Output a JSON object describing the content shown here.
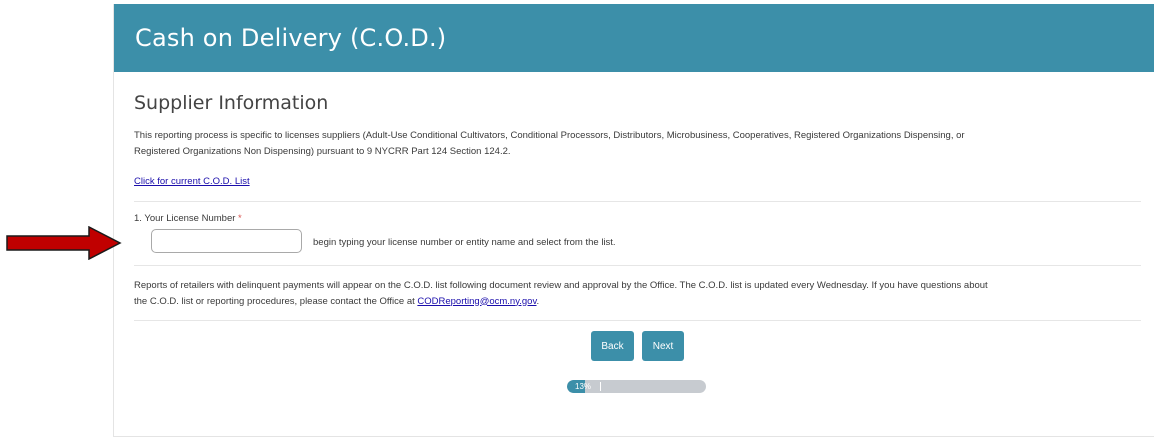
{
  "header": {
    "title": "Cash on Delivery (C.O.D.)",
    "background_color": "#3c8fa9"
  },
  "section": {
    "title": "Supplier Information",
    "intro_line1": "This reporting process is specific to licenses suppliers (Adult-Use Conditional Cultivators, Conditional Processors, Distributors, Microbusiness, Cooperatives, Registered Organizations Dispensing, or",
    "intro_line2": "Registered Organizations Non Dispensing) pursuant to 9 NYCRR Part 124 Section 124.2.",
    "cod_list_link": "Click for current C.O.D. List"
  },
  "license_field": {
    "label": "1. Your License Number",
    "required_marker": "*",
    "value": "",
    "placeholder": "",
    "help_text": "begin typing your license number or entity name and select from the list."
  },
  "notice": {
    "line1": "Reports of retailers with delinquent payments will appear on the C.O.D. list following document review and approval by the Office. The C.O.D. list is updated every Wednesday. If you have questions about",
    "line2_prefix": "the C.O.D. list or reporting procedures, please contact the Office at ",
    "email": "CODReporting@ocm.ny.gov",
    "line2_suffix": "."
  },
  "buttons": {
    "back_label": "Back",
    "next_label": "Next"
  },
  "progress": {
    "label": "13%",
    "percent": 13
  },
  "annotation": {
    "arrow_color": "#c00000"
  }
}
